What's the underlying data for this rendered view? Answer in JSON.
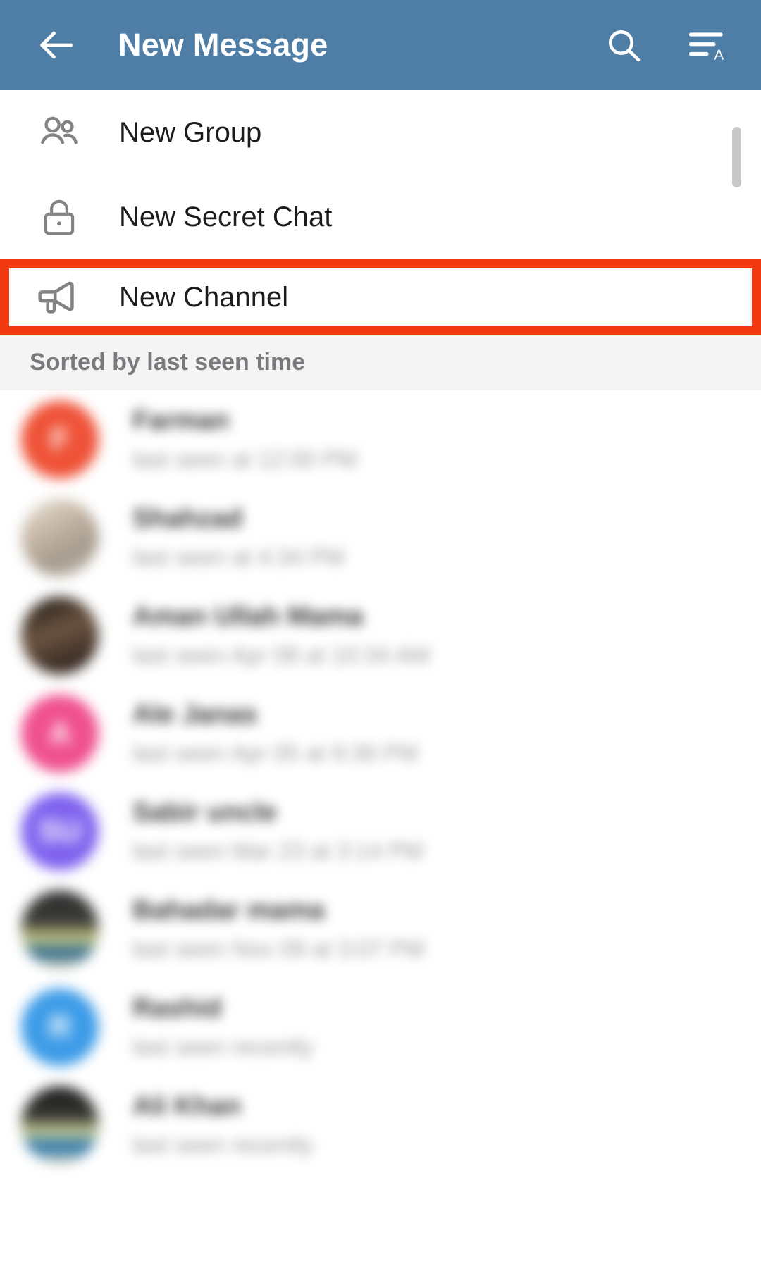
{
  "appbar": {
    "back_icon": "back-arrow-icon",
    "title": "New Message",
    "search_icon": "search-icon",
    "sort_icon": "sort-alphabetically-icon",
    "background_color": "#4e7da5",
    "text_color": "#ffffff"
  },
  "options": {
    "items": [
      {
        "icon": "group-people-icon",
        "label": "New Group",
        "highlighted": false
      },
      {
        "icon": "lock-icon",
        "label": "New Secret Chat",
        "highlighted": false
      },
      {
        "icon": "megaphone-icon",
        "label": "New Channel",
        "highlighted": true
      }
    ],
    "highlight_color": "#f23a10"
  },
  "section_header": {
    "label": "Sorted by last seen time",
    "background_color": "#f4f4f4",
    "text_color": "#77797c"
  },
  "contacts": {
    "items": [
      {
        "avatar_type": "color",
        "avatar_color": "#ef5237",
        "initial": "F",
        "name": "Farman",
        "status": "last seen at 12:00 PM"
      },
      {
        "avatar_type": "photo",
        "avatar_class": "photo-b",
        "initial": "",
        "name": "Shahzad",
        "status": "last seen at 4:34 PM"
      },
      {
        "avatar_type": "photo",
        "avatar_class": "photo-a",
        "initial": "",
        "name": "Aman Ullah Mama",
        "status": "last seen Apr 08 at 10:34 AM"
      },
      {
        "avatar_type": "color",
        "avatar_color": "#f0508f",
        "initial": "A",
        "name": "Ale Janas",
        "status": "last seen Apr 05 at 9:36 PM"
      },
      {
        "avatar_type": "color",
        "avatar_color": "#7f62ef",
        "initial": "SU",
        "name": "Sabir uncle",
        "status": "last seen Mar 23 at 3:14 PM"
      },
      {
        "avatar_type": "photo",
        "avatar_class": "photo-c",
        "initial": "",
        "name": "Bahadar mama",
        "status": "last seen Nov 09 at 3:07 PM"
      },
      {
        "avatar_type": "color",
        "avatar_color": "#3d9ce8",
        "initial": "R",
        "name": "Rashid",
        "status": "last seen recently"
      },
      {
        "avatar_type": "photo",
        "avatar_class": "photo-d",
        "initial": "",
        "name": "Ali Khan",
        "status": "last seen recently"
      }
    ]
  },
  "scrollbar": {
    "color": "#c6c8ca"
  }
}
